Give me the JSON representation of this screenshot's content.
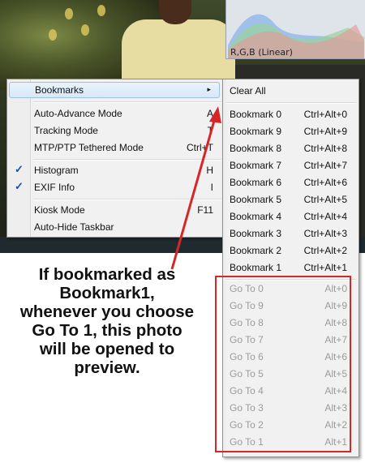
{
  "histogram": {
    "label": "R,G,B (Linear)"
  },
  "main_menu": {
    "items": [
      {
        "label": "Bookmarks",
        "shortcut": "",
        "submenu": true
      },
      {
        "label": "Auto-Advance Mode",
        "shortcut": "A"
      },
      {
        "label": "Tracking Mode",
        "shortcut": "T"
      },
      {
        "label": "MTP/PTP Tethered Mode",
        "shortcut": "Ctrl+T"
      },
      {
        "label": "Histogram",
        "shortcut": "H",
        "checked": true
      },
      {
        "label": "EXIF Info",
        "shortcut": "I",
        "checked": true
      },
      {
        "label": "Kiosk Mode",
        "shortcut": "F11"
      },
      {
        "label": "Auto-Hide Taskbar",
        "shortcut": ""
      }
    ],
    "submenu_arrow": "▸",
    "check_mark": "✓"
  },
  "bookmarks_menu": {
    "clear_all": "Clear All",
    "bookmarks": [
      {
        "label": "Bookmark 0",
        "shortcut": "Ctrl+Alt+0"
      },
      {
        "label": "Bookmark 9",
        "shortcut": "Ctrl+Alt+9"
      },
      {
        "label": "Bookmark 8",
        "shortcut": "Ctrl+Alt+8"
      },
      {
        "label": "Bookmark 7",
        "shortcut": "Ctrl+Alt+7"
      },
      {
        "label": "Bookmark 6",
        "shortcut": "Ctrl+Alt+6"
      },
      {
        "label": "Bookmark 5",
        "shortcut": "Ctrl+Alt+5"
      },
      {
        "label": "Bookmark 4",
        "shortcut": "Ctrl+Alt+4"
      },
      {
        "label": "Bookmark 3",
        "shortcut": "Ctrl+Alt+3"
      },
      {
        "label": "Bookmark 2",
        "shortcut": "Ctrl+Alt+2"
      },
      {
        "label": "Bookmark 1",
        "shortcut": "Ctrl+Alt+1"
      }
    ],
    "goto": [
      {
        "label": "Go To 0",
        "shortcut": "Alt+0"
      },
      {
        "label": "Go To 9",
        "shortcut": "Alt+9"
      },
      {
        "label": "Go To 8",
        "shortcut": "Alt+8"
      },
      {
        "label": "Go To 7",
        "shortcut": "Alt+7"
      },
      {
        "label": "Go To 6",
        "shortcut": "Alt+6"
      },
      {
        "label": "Go To 5",
        "shortcut": "Alt+5"
      },
      {
        "label": "Go To 4",
        "shortcut": "Alt+4"
      },
      {
        "label": "Go To 3",
        "shortcut": "Alt+3"
      },
      {
        "label": "Go To 2",
        "shortcut": "Alt+2"
      },
      {
        "label": "Go To 1",
        "shortcut": "Alt+1"
      }
    ]
  },
  "annotation": {
    "lines": [
      "If bookmarked as",
      "Bookmark1,",
      "whenever you choose",
      "Go To 1, this photo",
      "will be opened to",
      "preview."
    ],
    "arrow_color": "#d42828",
    "box_color": "#d42828"
  }
}
